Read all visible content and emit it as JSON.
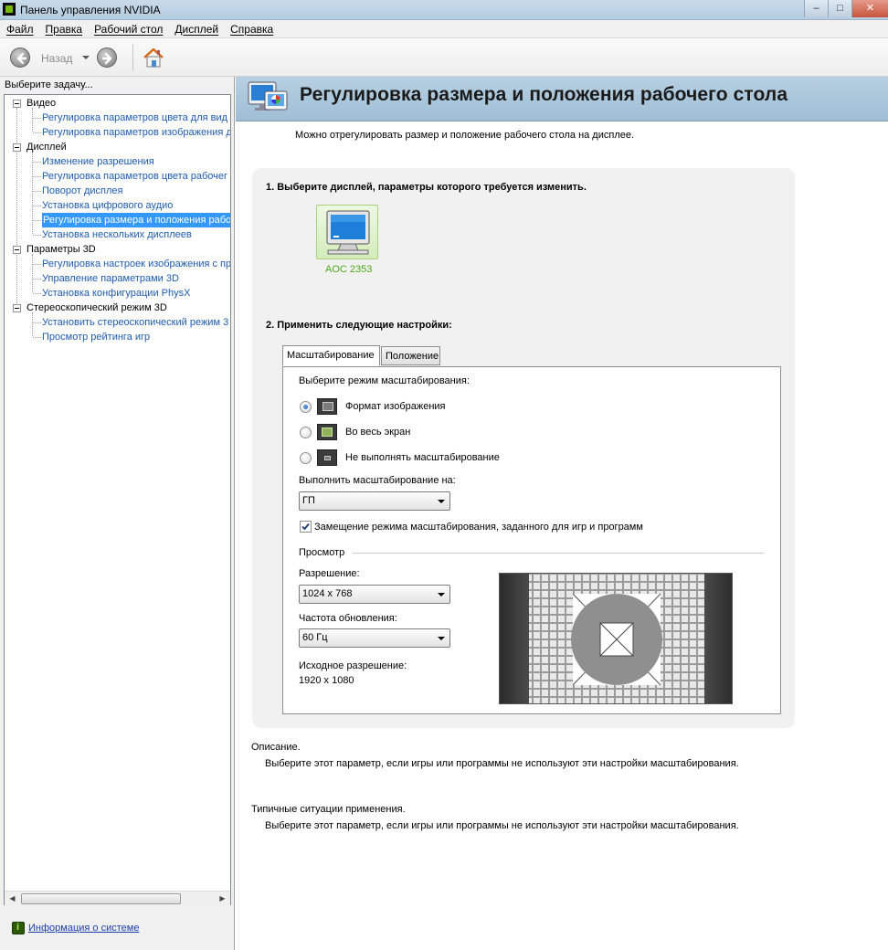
{
  "window": {
    "title": "Панель управления NVIDIA",
    "min_label": "–",
    "max_label": "□",
    "close_label": "✕"
  },
  "menu": [
    "Файл",
    "Правка",
    "Рабочий стол",
    "Дисплей",
    "Справка"
  ],
  "toolbar": {
    "back_label": "Назад",
    "icons": [
      "back-arrow-icon",
      "forward-arrow-icon",
      "home-icon"
    ]
  },
  "sidebar": {
    "label": "Выберите задачу...",
    "tree": [
      {
        "label": "Видео",
        "children": [
          "Регулировка параметров цвета для вид",
          "Регулировка параметров изображения д"
        ]
      },
      {
        "label": "Дисплей",
        "children": [
          "Изменение разрешения",
          "Регулировка параметров цвета рабочег",
          "Поворот дисплея",
          "Установка цифрового аудио",
          "Регулировка размера и положения рабо",
          "Установка нескольких дисплеев"
        ]
      },
      {
        "label": "Параметры 3D",
        "children": [
          "Регулировка настроек изображения с пр",
          "Управление параметрами 3D",
          "Установка конфигурации PhysX"
        ]
      },
      {
        "label": "Стереоскопический режим 3D",
        "children": [
          "Установить стереоскопический режим 3",
          "Просмотр рейтинга игр"
        ]
      }
    ],
    "selected": "Регулировка размера и положения рабо",
    "system_info": "Информация о системе"
  },
  "page": {
    "title": "Регулировка размера и положения рабочего стола",
    "intro": "Можно отрегулировать размер и положение рабочего стола на дисплее.",
    "step1": "1. Выберите дисплей, параметры которого требуется изменить.",
    "display_name": "AOC 2353",
    "step2": "2. Применить следующие настройки:",
    "tabs": [
      "Масштабирование",
      "Положение"
    ],
    "scaling_prompt": "Выберите режим масштабирования:",
    "scaling_options": [
      {
        "label": "Формат изображения",
        "selected": true
      },
      {
        "label": "Во весь экран",
        "selected": false
      },
      {
        "label": "Не выполнять масштабирование",
        "selected": false
      }
    ],
    "perform_on_label": "Выполнить масштабирование на:",
    "perform_on_value": "ГП",
    "override_label": "Замещение режима масштабирования, заданного для игр и программ",
    "override_checked": true,
    "preview_label": "Просмотр",
    "resolution_label": "Разрешение:",
    "resolution_value": "1024 x 768",
    "refresh_label": "Частота обновления:",
    "refresh_value": "60 Гц",
    "native_label": "Исходное разрешение:",
    "native_value": "1920 x 1080",
    "description_title": "Описание.",
    "description_text": "Выберите этот параметр, если игры или программы не используют эти настройки масштабирования.",
    "usage_title": "Типичные ситуации применения.",
    "usage_text": "Выберите этот параметр, если игры или программы не используют эти настройки масштабирования."
  },
  "colors": {
    "nvidia_green": "#76b900",
    "link_blue": "#1e5bb0",
    "selection": "#3399ff",
    "banner": "#b8d0e2"
  }
}
